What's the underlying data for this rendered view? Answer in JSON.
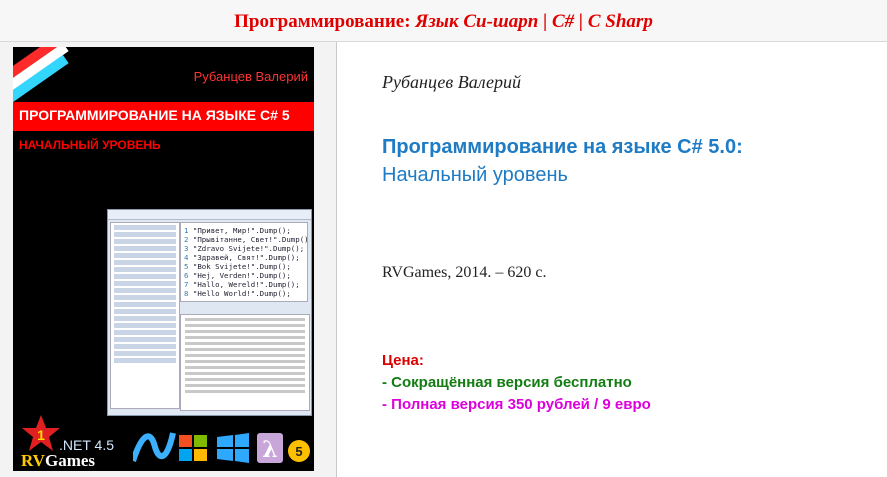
{
  "header": {
    "title_prefix": "Программирование: ",
    "title_suffix": "Язык Си-шарп | C# | C Sharp"
  },
  "cover": {
    "author": "Рубанцев Валерий",
    "band_title": "ПРОГРАММИРОВАНИЕ НА ЯЗЫКЕ C# 5",
    "subtitle": "НАЧАЛЬНЫЙ УРОВЕНЬ",
    "code_lines": [
      {
        "n": "1",
        "text": "\"Привет, Мир!\".Dump();"
      },
      {
        "n": "2",
        "text": "\"Прывітанне, Свет!\".Dump();"
      },
      {
        "n": "3",
        "text": "\"Zdravo Svijete!\".Dump();"
      },
      {
        "n": "4",
        "text": "\"Здравей, Свят!\".Dump();"
      },
      {
        "n": "5",
        "text": "\"Bok Svijete!\".Dump();"
      },
      {
        "n": "6",
        "text": "\"Hej, Verden!\".Dump();"
      },
      {
        "n": "7",
        "text": "\"Hallo, Wereld!\".Dump();"
      },
      {
        "n": "8",
        "text": "\"Hello World!\".Dump();"
      }
    ],
    "net_label": ".NET 4.5",
    "brand_r": "RV",
    "brand_rest": "Games",
    "badge_number": "1",
    "logo_number": "5",
    "colors": {
      "band": "#ff0000",
      "background": "#000000"
    }
  },
  "book": {
    "author": "Рубанцев Валерий",
    "title": "Программирование на языке C# 5.0:",
    "subtitle": "Начальный уровень",
    "publisher": "RVGames, 2014. – 620 с."
  },
  "price": {
    "label": "Цена:",
    "free": "- Сокращённая версия бесплатно",
    "full": "- Полная версия 350 рублей / 9 евро"
  },
  "colors": {
    "header_title": "#e00000",
    "title": "#1e7bc4",
    "price_label": "#dd0000",
    "price_free": "#137c13",
    "price_full": "#dd00dd"
  }
}
